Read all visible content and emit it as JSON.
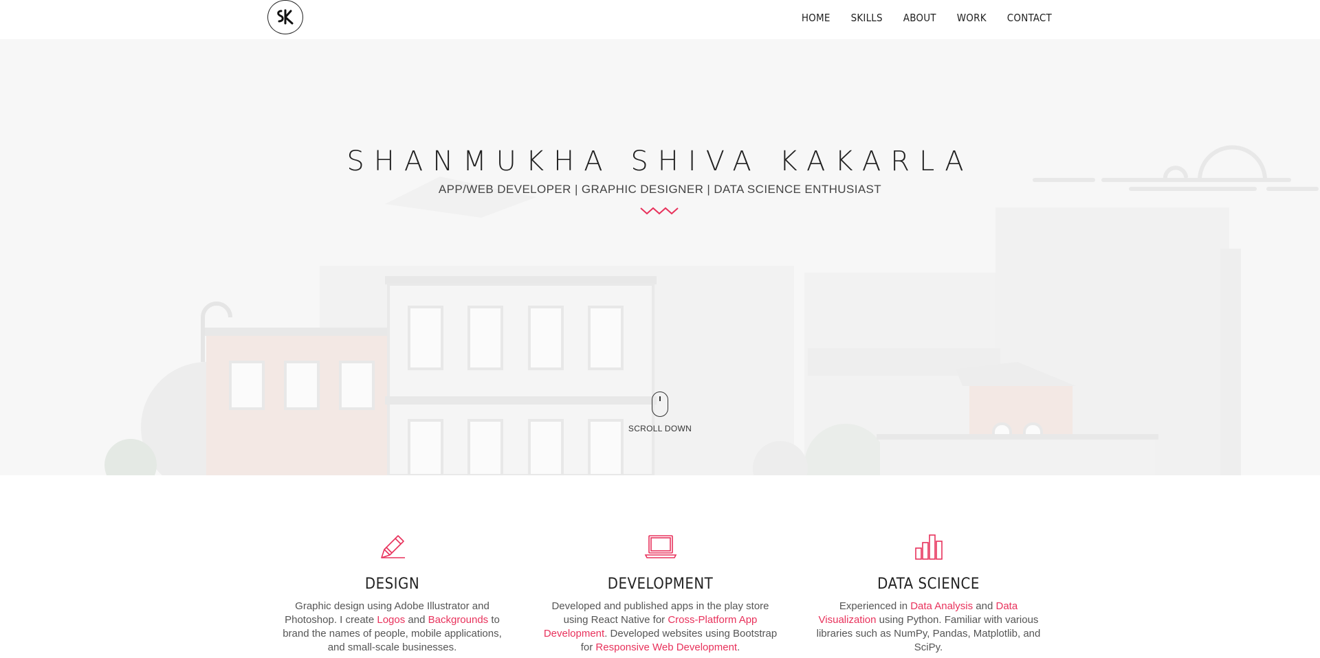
{
  "nav": {
    "logo_text": "SK",
    "items": [
      {
        "label": "HOME"
      },
      {
        "label": "SKILLS"
      },
      {
        "label": "ABOUT"
      },
      {
        "label": "WORK"
      },
      {
        "label": "CONTACT"
      }
    ]
  },
  "hero": {
    "title": "SHANMUKHA SHIVA KAKARLA",
    "subtitle": "APP/WEB DEVELOPER | GRAPHIC DESIGNER | DATA SCIENCE ENTHUSIAST",
    "scroll_label": "SCROLL DOWN"
  },
  "services": [
    {
      "icon": "pencil-icon",
      "title": "DESIGN",
      "text": [
        {
          "t": "Graphic design using Adobe Illustrator and Photoshop. I create "
        },
        {
          "t": "Logos",
          "hl": true
        },
        {
          "t": " and "
        },
        {
          "t": "Backgrounds",
          "hl": true
        },
        {
          "t": " to brand the names of people, mobile applications, and small-scale businesses."
        }
      ]
    },
    {
      "icon": "laptop-icon",
      "title": "DEVELOPMENT",
      "text": [
        {
          "t": "Developed and published apps in the play store using React Native for "
        },
        {
          "t": "Cross-Platform App Development",
          "hl": true
        },
        {
          "t": ". Developed websites using Bootstrap for "
        },
        {
          "t": "Responsive Web Development",
          "hl": true
        },
        {
          "t": "."
        }
      ]
    },
    {
      "icon": "bar-chart-icon",
      "title": "DATA SCIENCE",
      "text": [
        {
          "t": "Experienced in "
        },
        {
          "t": "Data Analysis",
          "hl": true
        },
        {
          "t": " and "
        },
        {
          "t": "Data Visualization",
          "hl": true
        },
        {
          "t": " using Python. Familiar with various libraries such as NumPy, Pandas, Matplotlib, and SciPy."
        }
      ]
    }
  ],
  "colors": {
    "accent": "#e8315b",
    "hero_bg": "#f7f7f7",
    "text": "#222222"
  }
}
